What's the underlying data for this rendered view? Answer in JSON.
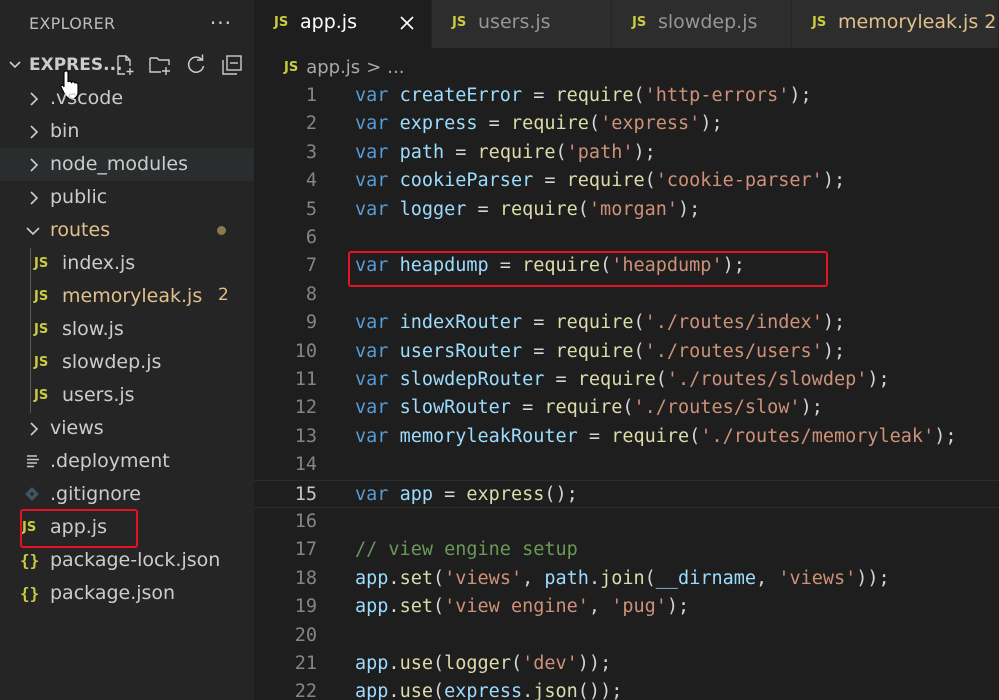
{
  "sidebar": {
    "title": "EXPLORER",
    "more": "···",
    "folder": "EXPRES...",
    "items": [
      {
        "label": ".vscode",
        "type": "folder"
      },
      {
        "label": "bin",
        "type": "folder"
      },
      {
        "label": "node_modules",
        "type": "folder"
      },
      {
        "label": "public",
        "type": "folder"
      },
      {
        "label": "routes",
        "type": "folder-open"
      },
      {
        "label": "index.js",
        "type": "js"
      },
      {
        "label": "memoryleak.js",
        "type": "js",
        "badge": "2"
      },
      {
        "label": "slow.js",
        "type": "js"
      },
      {
        "label": "slowdep.js",
        "type": "js"
      },
      {
        "label": "users.js",
        "type": "js"
      },
      {
        "label": "views",
        "type": "folder"
      },
      {
        "label": ".deployment",
        "type": "file"
      },
      {
        "label": ".gitignore",
        "type": "git"
      },
      {
        "label": "app.js",
        "type": "js"
      },
      {
        "label": "package-lock.json",
        "type": "json"
      },
      {
        "label": "package.json",
        "type": "json"
      }
    ],
    "js_badge": "JS",
    "json_badge": "{}"
  },
  "tabs": [
    {
      "label": "app.js",
      "icon": "JS"
    },
    {
      "label": "users.js",
      "icon": "JS"
    },
    {
      "label": "slowdep.js",
      "icon": "JS"
    },
    {
      "label": "memoryleak.js 2",
      "icon": "JS"
    }
  ],
  "breadcrumb": {
    "icon": "JS",
    "file": "app.js",
    "sep": ">",
    "more": "..."
  },
  "editor": {
    "line_numbers": [
      "1",
      "2",
      "3",
      "4",
      "5",
      "6",
      "7",
      "8",
      "9",
      "10",
      "11",
      "12",
      "13",
      "14",
      "15",
      "16",
      "17",
      "18",
      "19",
      "20",
      "21",
      "22"
    ],
    "current_line": 15
  },
  "colors": {
    "highlight": "#e81123",
    "keyword": "#569cd6",
    "string": "#ce9178",
    "function": "#dcdcaa",
    "variable": "#9cdcfe",
    "comment": "#6a9955"
  }
}
